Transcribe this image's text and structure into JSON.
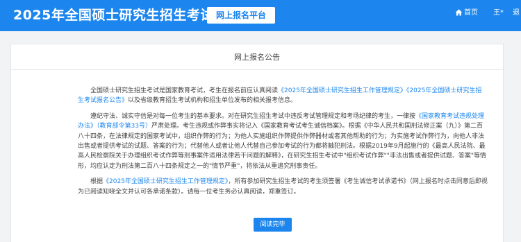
{
  "header": {
    "title": "2025年全国硕士研究生招生考试",
    "platform": "网上报名平台",
    "home": "首页",
    "user": "王*",
    "logout": "退"
  },
  "notice": {
    "title": "网上报名公告",
    "p1": {
      "t1": "全国硕士研究生招生考试是国家教育考试，考生在报名前应认真阅读",
      "l1": "《2025年全国硕士研究生招生工作管理规定》",
      "l2": "《2025年全国硕士研究生招生考试报名公告》",
      "t2": "以及省级教育招生考试机构和招生单位发布的相关报考信息。"
    },
    "p2": {
      "t1": "遵纪守法、诚实守信是对每一位考生的基本要求。对在研究生招生考试中违反考试管理规定和考场纪律的考生，一律按",
      "l1": "《国家教育考试违规处理办法》（教育部令第33号）",
      "t2": "严肃处理。考生违规或作弊事实将记入《国家教育考试考生诚信档案》。根据《中华人民共和国刑法修正案（九）》第二百八十四条，在法律规定的国家考试中，组织作弊的行为；为他人实施组织作弊提供作弊器材或者其他帮助的行为；为实施考试作弊行为，向他人非法出售或者提供考试的试题、答案的行为；代替他人或者让他人代替自己参加考试的行为都将触犯刑法。根据2019年9月起施行的《最高人民法院、最高人民检察院关于办理组织考试作弊等刑事案件适用法律若干问题的解释》，在研究生招生考试中\"组织考试作弊\"\"非法出售或者提供试题、答案\"等情形，均应认定为刑法第二百八十四条规定之一的\"情节严重\"，将依法从重追究刑事责任。"
    },
    "p3": {
      "t1": "根据",
      "l1": "《2025年全国硕士研究生招生工作管理规定》",
      "t2": "，所有参加研究生招生考试的考生须签署《考生诚信考试承诺书》（网上报名时点击同意后即视为已阅读知晓全文并认可各承诺条款）。请每一位考生务必认真阅读，郑重签订。"
    },
    "button": "阅读完毕"
  },
  "colors": {
    "primary": "#1c86ee",
    "background": "#f2f3f5"
  },
  "icons": {
    "home": "home-icon"
  }
}
